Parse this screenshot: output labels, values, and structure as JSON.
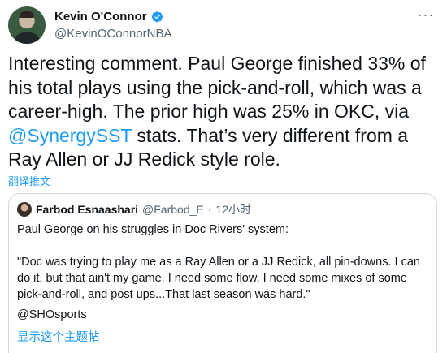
{
  "author": {
    "name": "Kevin O'Connor",
    "handle": "@KevinOConnorNBA",
    "avatar_icon": "profile-photo",
    "verified_icon": "verified-badge-icon"
  },
  "tweet": {
    "text_before": "Interesting comment. Paul George finished 33% of his total plays using the pick-and-roll, which was a career-high. The prior high was 25% in OKC, via ",
    "mention": "@SynergySST",
    "text_after": " stats. That’s very different from a Ray Allen or JJ Redick style role."
  },
  "translate_label": "翻译推文",
  "quoted": {
    "name": "Farbod Esnaashari",
    "handle": "@Farbod_E",
    "separator": "·",
    "time": "12小时",
    "line1": "Paul George on his struggles in Doc Rivers' system:",
    "quote": "\"Doc was trying to play me as a Ray Allen or a JJ Redick, all pin-downs. I can do it, but that ain't my game. I need some flow, I need some mixes of some pick-and-roll, and post ups...That last season was hard.\"",
    "signature": "@SHOsports",
    "show_thread": "显示这个主题帖"
  },
  "colors": {
    "link": "#1d9bf0",
    "secondary_text": "#536471",
    "border": "#cfd9de"
  }
}
